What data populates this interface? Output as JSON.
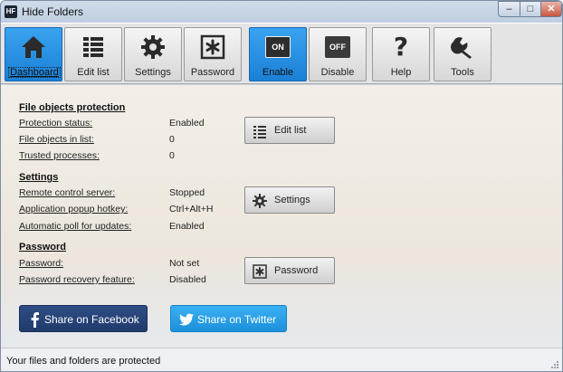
{
  "window": {
    "title": "Hide Folders",
    "app_icon_text": "HF",
    "controls": {
      "minimize": "–",
      "maximize": "□",
      "close": "✕"
    }
  },
  "toolbar": {
    "buttons": [
      {
        "label": "Dashboard",
        "icon": "home-icon",
        "active": true
      },
      {
        "label": "Edit list",
        "icon": "list-icon"
      },
      {
        "label": "Settings",
        "icon": "gear-icon"
      },
      {
        "label": "Password",
        "icon": "asterisk-icon"
      },
      {
        "label": "Enable",
        "icon": "on-switch-icon",
        "icon_text": "ON"
      },
      {
        "label": "Disable",
        "icon": "off-switch-icon",
        "icon_text": "OFF"
      },
      {
        "label": "Help",
        "icon": "question-icon"
      },
      {
        "label": "Tools",
        "icon": "wrench-icon"
      }
    ]
  },
  "sections": {
    "file_objects": {
      "title": "File objects protection",
      "rows": [
        {
          "label": "Protection status:",
          "value": "Enabled"
        },
        {
          "label": "File objects in list:",
          "value": "0"
        },
        {
          "label": "Trusted processes:",
          "value": "0"
        }
      ],
      "button": "Edit list"
    },
    "settings": {
      "title": "Settings",
      "rows": [
        {
          "label": "Remote control server:",
          "value": "Stopped"
        },
        {
          "label": "Application popup hotkey:",
          "value": "Ctrl+Alt+H"
        },
        {
          "label": "Automatic poll for updates:",
          "value": "Enabled"
        }
      ],
      "button": "Settings"
    },
    "password": {
      "title": "Password",
      "rows": [
        {
          "label": "Password:",
          "value": "Not set"
        },
        {
          "label": "Password recovery feature:",
          "value": "Disabled"
        }
      ],
      "button": "Password"
    }
  },
  "share": {
    "facebook": "Share on Facebook",
    "twitter": "Share on Twitter"
  },
  "status": {
    "text": "Your files and folders are protected"
  },
  "colors": {
    "accent_blue": "#1a80d6",
    "facebook": "#203b6c",
    "twitter": "#1c90db"
  }
}
